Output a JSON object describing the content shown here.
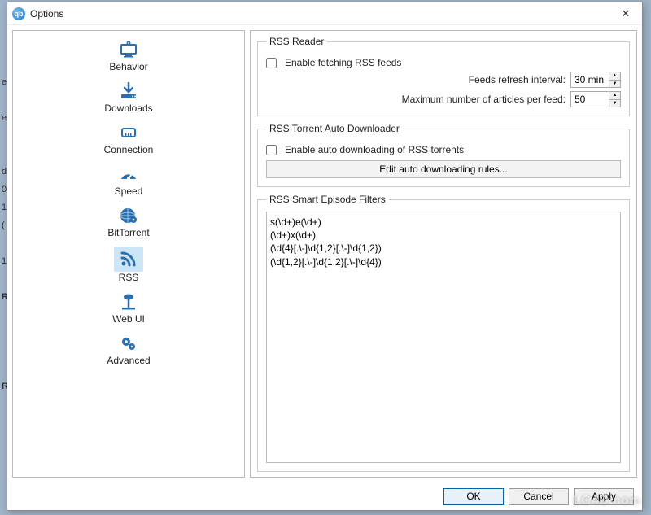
{
  "window": {
    "title": "Options",
    "app_badge": "qb"
  },
  "nav": {
    "items": [
      {
        "label": "Behavior"
      },
      {
        "label": "Downloads"
      },
      {
        "label": "Connection"
      },
      {
        "label": "Speed"
      },
      {
        "label": "BitTorrent"
      },
      {
        "label": "RSS"
      },
      {
        "label": "Web UI"
      },
      {
        "label": "Advanced"
      }
    ],
    "selected_index": 5
  },
  "rss_reader": {
    "legend": "RSS Reader",
    "enable_label": "Enable fetching RSS feeds",
    "enable_checked": false,
    "refresh_label": "Feeds refresh interval:",
    "refresh_value": "30 min",
    "max_articles_label": "Maximum number of articles per feed:",
    "max_articles_value": "50"
  },
  "rss_auto": {
    "legend": "RSS Torrent Auto Downloader",
    "enable_label": "Enable auto downloading of RSS torrents",
    "enable_checked": false,
    "edit_rules_label": "Edit auto downloading rules..."
  },
  "rss_filters": {
    "legend": "RSS Smart Episode Filters",
    "value": "s(\\d+)e(\\d+)\n(\\d+)x(\\d+)\n(\\d{4}[.\\-]\\d{1,2}[.\\-]\\d{1,2})\n(\\d{1,2}[.\\-]\\d{1,2}[.\\-]\\d{4})"
  },
  "buttons": {
    "ok": "OK",
    "cancel": "Cancel",
    "apply": "Apply"
  },
  "watermark": "LO4D.com"
}
